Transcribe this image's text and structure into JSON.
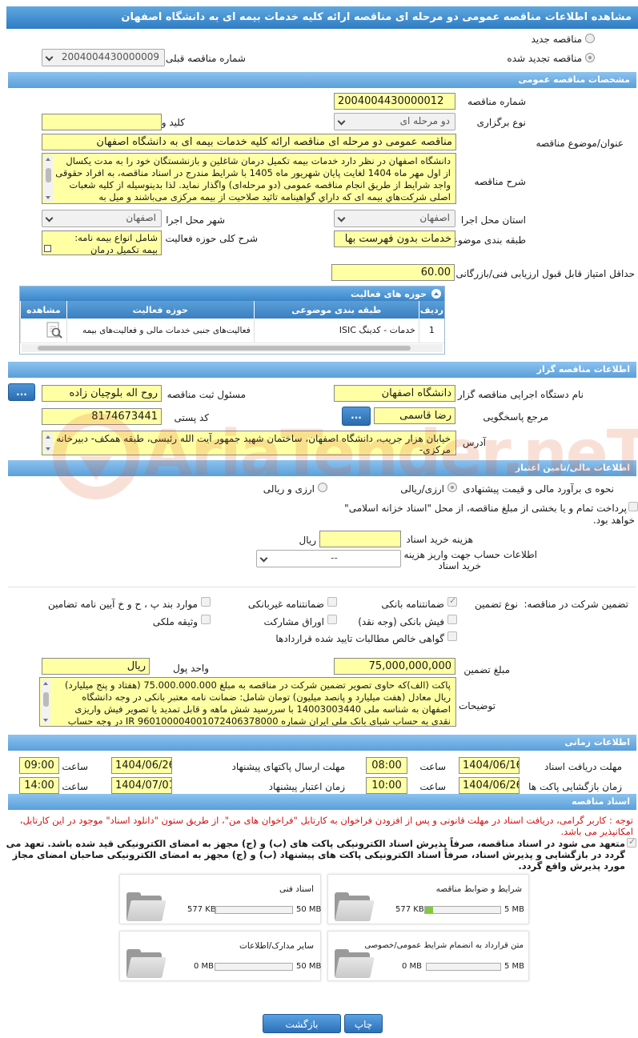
{
  "page_title": "مشاهده اطلاعات مناقصه عمومی دو مرحله ای مناقصه ارائه کلیه خدمات بیمه ای به دانشگاه اصفهان",
  "tender_type": {
    "new_label": "مناقصه جدید",
    "renewed_label": "مناقصه تجدید شده",
    "previous_number_label": "شماره مناقصه قبلی",
    "previous_number_value": "2004004430000009"
  },
  "general": {
    "section_title": "مشخصات مناقصه عمومی",
    "number_label": "شماره مناقصه",
    "number_value": "2004004430000012",
    "holding_type_label": "نوع برگزاری",
    "holding_type_value": "دو مرحله ای",
    "keyword_label": "کلید واژه",
    "keyword_value": "",
    "subject_label": "عنوان/موضوع مناقصه",
    "subject_value": "مناقصه عمومی دو مرحله ای مناقصه ارائه کلیه خدمات بیمه ای به دانشگاه اصفهان",
    "description_label": "شرح مناقصه",
    "description_lines": [
      "دانشگاه اصفهان در نظر دارد خدمات بیمه تکمیل درمان شاغلین و بازنشستگان خود را به مدت یکسال",
      "از اول مهر ماه 1404 لغایت پایان شهریور ماه 1405 با شرایط مندرج در اسناد مناقصه، به افراد حقوقی",
      "واجد شرایط از طریق انجام مناقصه عمومی (دو مرحله‌ای) واگذار نماید. لذا بدینوسیله از کلیه شعبات",
      "اصلی شرکت‌هاي بیمه ای که داراي گواهینامه تائید صلاحیت از بیمه مرکزی می‌باشند و میل به"
    ],
    "province_label": "استان محل اجرا",
    "province_value": "اصفهان",
    "city_label": "شهر محل اجرا",
    "city_value": "اصفهان",
    "category_label": "طبقه بندی موضوعی",
    "category_value": "خدمات بدون فهرست بها",
    "activity_scope_label": "شرح کلی حوزه فعالیت",
    "activity_scope_line1": "شامل انواع بیمه نامه:",
    "activity_scope_line2": "بیمه تکمیل درمان",
    "min_score_label": "حداقل امتیاز قابل قبول ارزیابی فنی/بازرگانی",
    "min_score_value": "60.00"
  },
  "activity_grid": {
    "title": "حوزه های فعالیت",
    "columns": [
      "ردیف",
      "طبقه بندی موضوعی",
      "حوزه فعالیت",
      "مشاهده"
    ],
    "rows": [
      {
        "row": "1",
        "category": "خدمات - کدینگ ISIC",
        "activity": "فعالیت‌های جنبی خدمات مالی و فعالیت‌های بیمه"
      }
    ]
  },
  "organizer": {
    "section_title": "اطلاعات مناقصه گزار",
    "org_label": "نام دستگاه اجرایی مناقصه گزار",
    "org_value": "دانشگاه اصفهان",
    "registrar_label": "مسئول ثبت مناقصه",
    "registrar_value": "روح اله بلوچیان زاده",
    "dots_label": "...",
    "responder_label": "مرجع پاسخگویی",
    "responder_value": "رضا قاسمی",
    "postal_label": "کد پستی",
    "postal_value": "8174673441",
    "address_label": "آدرس",
    "address_value": "خیابان هزار جریب، دانشگاه اصفهان، ساختمان شهید جمهور آیت الله رئیسی، طبقه همکف- دبیرخانه مرکزی-"
  },
  "finance": {
    "section_title": "اطلاعات مالی/تامین اعتبار",
    "estimate_label": "نحوه ی برآورد مالی و قیمت پیشنهادی",
    "estimate_opt1": "ارزی/ریالی",
    "estimate_opt2": "ارزی و ریالی",
    "treasury_text_line1": "پرداخت تمام و یا بخشی از مبلغ مناقصه، از محل \"اسناد خزانه اسلامی\"",
    "treasury_text_line2": "خواهد بود.",
    "doc_fee_label": "هزینه خرید اسناد",
    "doc_fee_value": "",
    "doc_fee_unit": "ریال",
    "account_label_line1": "اطلاعات حساب جهت واریز هزینه",
    "account_label_line2": "خرید اسناد",
    "account_value": "--"
  },
  "guarantee": {
    "participation_label": "تضمین شرکت در مناقصه:",
    "type_label": "نوع تضمین",
    "options": {
      "bank_guarantee": "ضمانتنامه بانکی",
      "non_bank_guarantee": "ضمانتنامه غیربانکی",
      "regulation_items": "موارد بند پ ، ح و خ آیین نامه تضامین",
      "bank_receipt": "فیش بانکی (وجه نقد)",
      "bonds": "اوراق مشارکت",
      "property": "وثیقه ملکی",
      "contract_claims": "گواهی خالص مطالبات تایید شده قراردادها"
    },
    "amount_label": "مبلغ تضمین",
    "amount_value": "75,000,000,000",
    "currency_label": "واحد پول",
    "currency_value": "ریال",
    "notes_label": "توضیحات",
    "notes_lines": [
      "پاکت (الف)که حاوی تصویر تضمین شرکت در مناقصه به مبلغ 75.000.000.000 (هفتاد و پنج میلیارد)",
      "ریال معادل (هفت میلیارد و پانصد میلیون) تومان شامل: ضمانت نامه معتبر بانکی در وجه دانشگاه",
      "اصفهان به شناسه ملی 14003003440 با سررسید شش ماهه و قابل تمدید یا تصویر فیش واریزی",
      "نقدی به حساب شبای بانک ملی ایران شماره IR 960100004001072406378000 در وجه حساب"
    ]
  },
  "timing": {
    "section_title": "اطلاعات زمانی",
    "doc_receive_deadline_label": "مهلت دریافت اسناد",
    "doc_receive_date": "1404/06/16",
    "doc_receive_time": "08:00",
    "submit_deadline_label": "مهلت ارسال پاکتهای پیشنهاد",
    "submit_date": "1404/06/26",
    "submit_time": "09:00",
    "opening_label": "زمان بازگشایی پاکت ها",
    "opening_date": "1404/06/26",
    "opening_time": "10:00",
    "validity_label": "زمان اعتبار پیشنهاد",
    "validity_date": "1404/07/01",
    "validity_time": "14:00",
    "time_label": "ساعت"
  },
  "documents": {
    "section_title": "اسناد مناقصه",
    "red_note": "توجه : کاربر گرامی، دریافت اسناد در مهلت قانونی و پس از افزودن فراخوان به کارتابل \"فراخوان های من\"، از طریق ستون \"دانلود اسناد\" موجود در این کارتابل، امکانپذیر می باشد.",
    "bold_note": "متعهد می شود در اسناد مناقصه، صرفاً پذیرش اسناد الکترونیکی پاکت های (ب) و (ج) مجهز به امضای الکترونیکی قید شده باشد. تعهد می گردد در بازگشایی و پذیرش اسناد، صرفاً اسناد الکترونیکی پاکت های پیشنهاد (ب) و (ج) مجهز به امضای الکترونیکی صاحبان امضای مجاز مورد پذیرش واقع گردد.",
    "cards": [
      {
        "title": "شرایط و ضوابط مناقصه",
        "used": "577 KB",
        "max": "5 MB",
        "fill_fraction": 0.11
      },
      {
        "title": "اسناد فنی",
        "used": "577 KB",
        "max": "50 MB",
        "fill_fraction": 0.011
      },
      {
        "title": "متن قرارداد به انضمام شرایط عمومی/خصوصی",
        "used": "0 MB",
        "max": "5 MB",
        "fill_fraction": 0
      },
      {
        "title": "سایر مدارک/اطلاعات",
        "used": "0 MB",
        "max": "50 MB",
        "fill_fraction": 0
      }
    ]
  },
  "actions": {
    "print_label": "چاپ",
    "back_label": "بازگشت"
  },
  "watermark": "AriaTender.neT",
  "colors": {
    "title_bar": "#2f7cc4",
    "section_bar": "#5b9fd9",
    "field_yellow": "#ffffa4",
    "notice_red": "#d01010"
  }
}
